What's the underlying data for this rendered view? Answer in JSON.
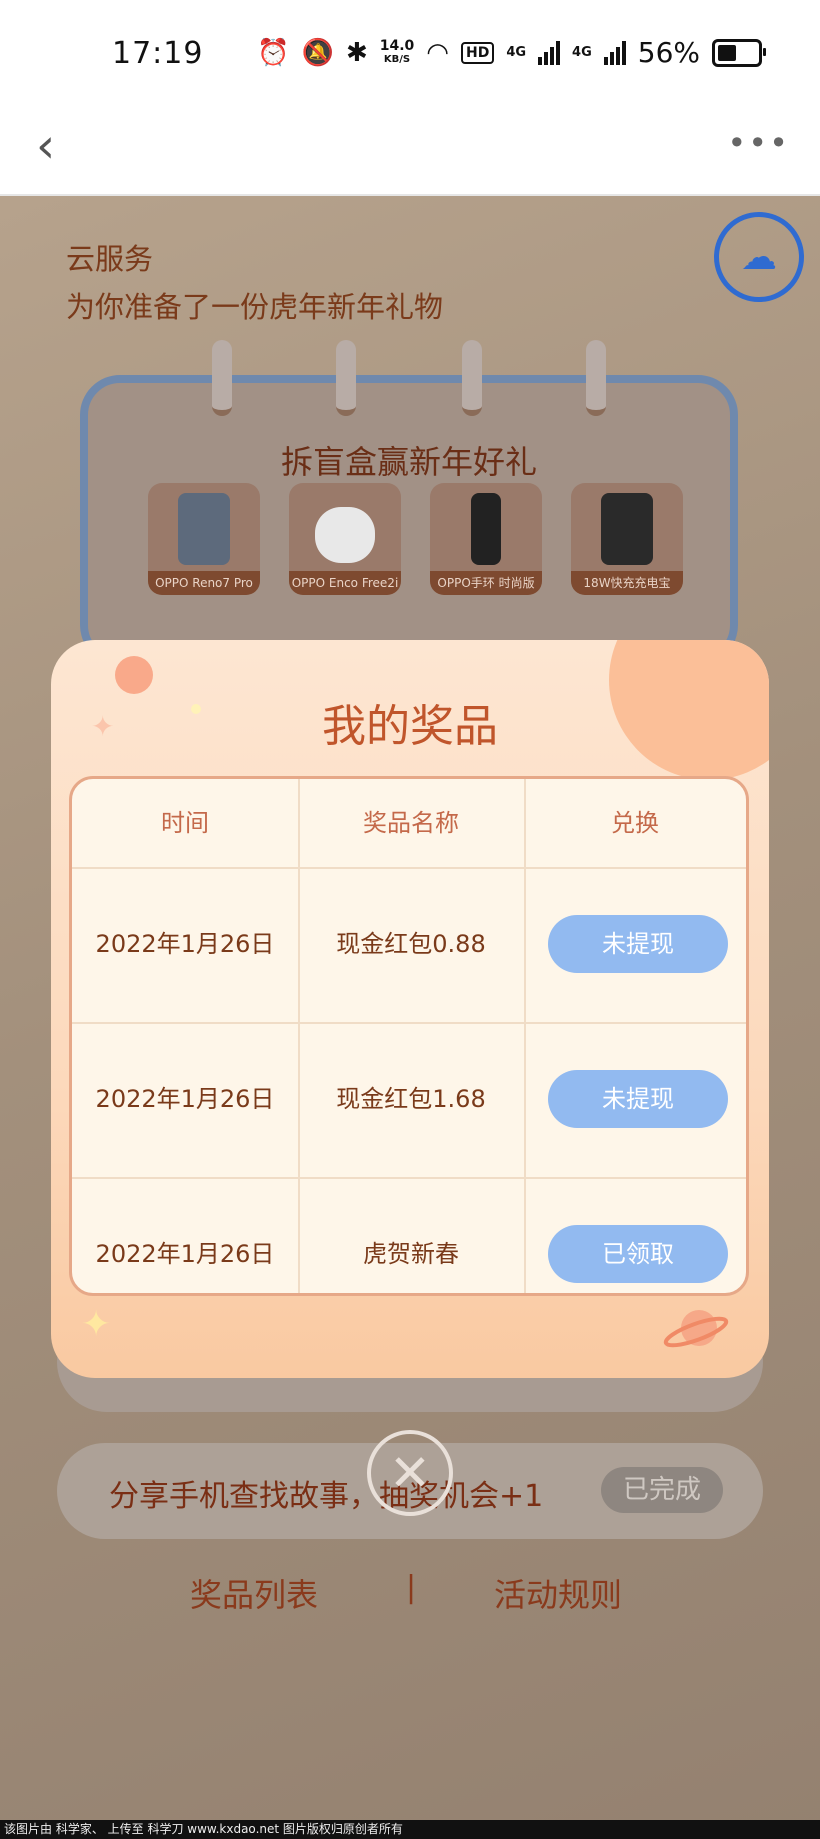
{
  "status_bar": {
    "time": "17:19",
    "net_speed_value": "14.0",
    "net_speed_unit": "KB/S",
    "hd_label": "HD",
    "signal1_label": "4G",
    "signal2_label": "4G",
    "battery": "56%"
  },
  "nav": {
    "back_icon": "chevron-left-icon",
    "more_icon": "more-dots-icon"
  },
  "page": {
    "headline_1": "云服务",
    "headline_2": "为你准备了一份虎年新年礼物",
    "calendar_title": "拆盲盒赢新年好礼",
    "prizes": [
      {
        "caption": "OPPO Reno7 Pro"
      },
      {
        "caption": "OPPO Enco Free2i"
      },
      {
        "caption": "OPPO手环 时尚版"
      },
      {
        "caption": "18W快充充电宝"
      }
    ],
    "task": {
      "label": "分享手机查找故事，抽奖机会+1",
      "status": "已完成"
    },
    "links": {
      "prizes": "奖品列表",
      "separator": "|",
      "rules": "活动规则"
    }
  },
  "modal": {
    "title": "我的奖品",
    "columns": [
      "时间",
      "奖品名称",
      "兑换"
    ],
    "rows": [
      {
        "date": "2022年1月26日",
        "prize": "现金红包0.88",
        "action": "未提现"
      },
      {
        "date": "2022年1月26日",
        "prize": "现金红包1.68",
        "action": "未提现"
      },
      {
        "date": "2022年1月26日",
        "prize": "虎贺新春",
        "action": "已领取"
      }
    ],
    "close_icon": "close-circle-icon"
  },
  "footer": "该图片由 科学家、 上传至 科学刀 www.kxdao.net 图片版权归原创者所有",
  "colors": {
    "pill": "#92baf0",
    "title": "#c0552b"
  }
}
